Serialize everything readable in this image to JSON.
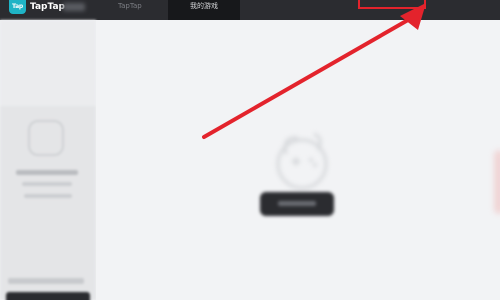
{
  "header": {
    "logo_text": "Tap",
    "brand": "TapTap",
    "app_name": "TapTap",
    "tab_label": "我的游戏"
  },
  "colors": {
    "topbar": "#2b2c30",
    "active_tab": "#17181b",
    "logo": "#1fb4c6",
    "annotation": "#e3232c"
  },
  "annotation": {
    "type": "arrow",
    "icon": "red-arrow-icon",
    "highlight": "red-rectangle"
  }
}
